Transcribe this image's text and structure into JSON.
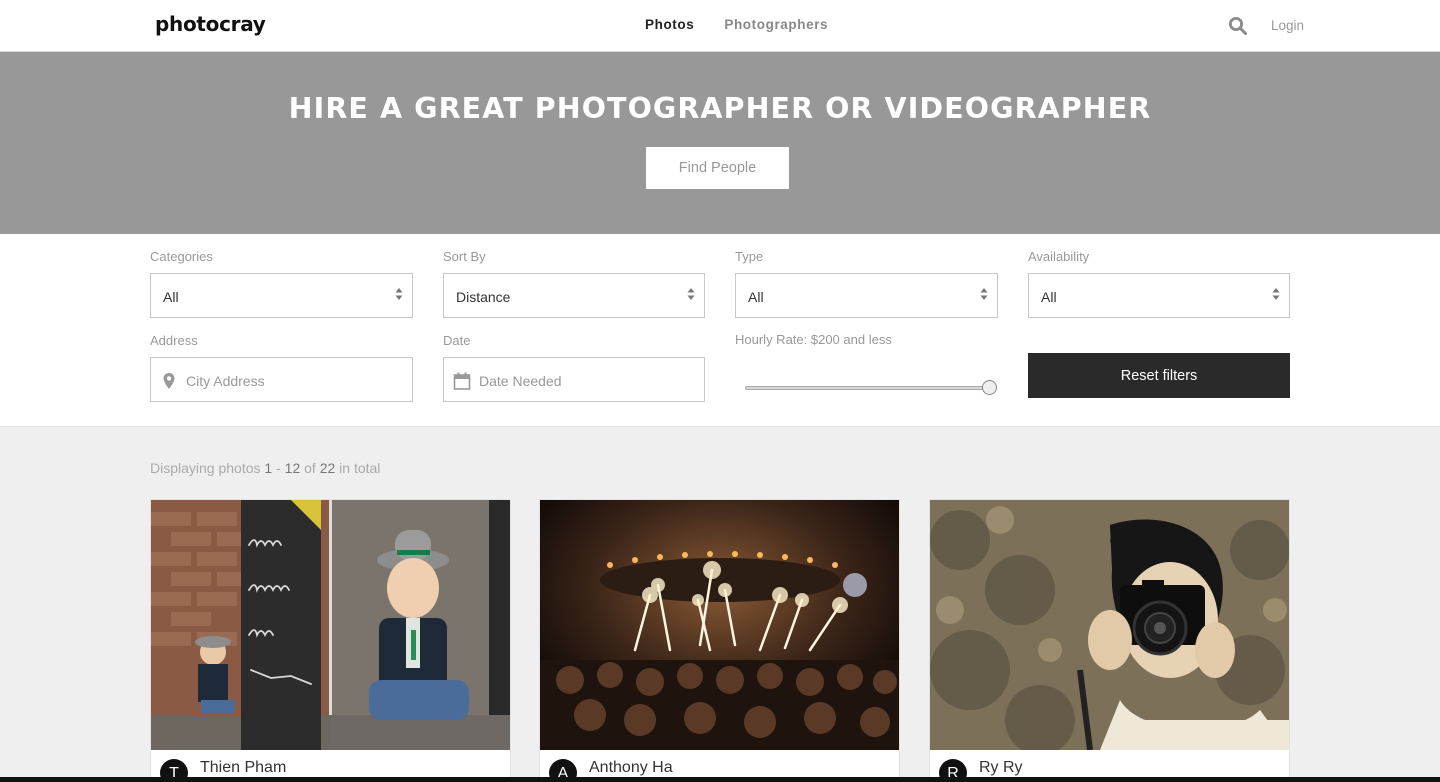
{
  "header": {
    "logo": "photocray",
    "nav": [
      {
        "label": "Photos",
        "active": true
      },
      {
        "label": "Photographers",
        "active": false
      }
    ],
    "search_icon": "search-icon",
    "login": "Login"
  },
  "hero": {
    "title": "HIRE A GREAT PHOTOGRAPHER OR VIDEOGRAPHER",
    "button": "Find People",
    "background": "#989898"
  },
  "filters": {
    "categories": {
      "label": "Categories",
      "value": "All"
    },
    "sort_by": {
      "label": "Sort By",
      "value": "Distance"
    },
    "type": {
      "label": "Type",
      "value": "All"
    },
    "availability": {
      "label": "Availability",
      "value": "All"
    },
    "address": {
      "label": "Address",
      "placeholder": "City Address",
      "icon": "map-pin-icon"
    },
    "date": {
      "label": "Date",
      "placeholder": "Date Needed",
      "icon": "calendar-icon"
    },
    "hourly_rate": {
      "label": "Hourly Rate: $200 and less",
      "max": 200,
      "level_fraction": 1.0
    },
    "reset": "Reset filters"
  },
  "results": {
    "prefix": "Displaying photos",
    "start": "1",
    "sep": "-",
    "end": "12",
    "of": "of",
    "total": "22",
    "suffix": "in total"
  },
  "cards": [
    {
      "initial": "T",
      "name": "Thien Pham",
      "photo": "birthday-toddler-photo"
    },
    {
      "initial": "A",
      "name": "Anthony Ha",
      "photo": "party-sparklers-photo"
    },
    {
      "initial": "R",
      "name": "Ry Ry",
      "photo": "photographer-camera-photo"
    }
  ],
  "colors": {
    "reset_button": "#2a2a2a",
    "page_background": "#efefef"
  }
}
